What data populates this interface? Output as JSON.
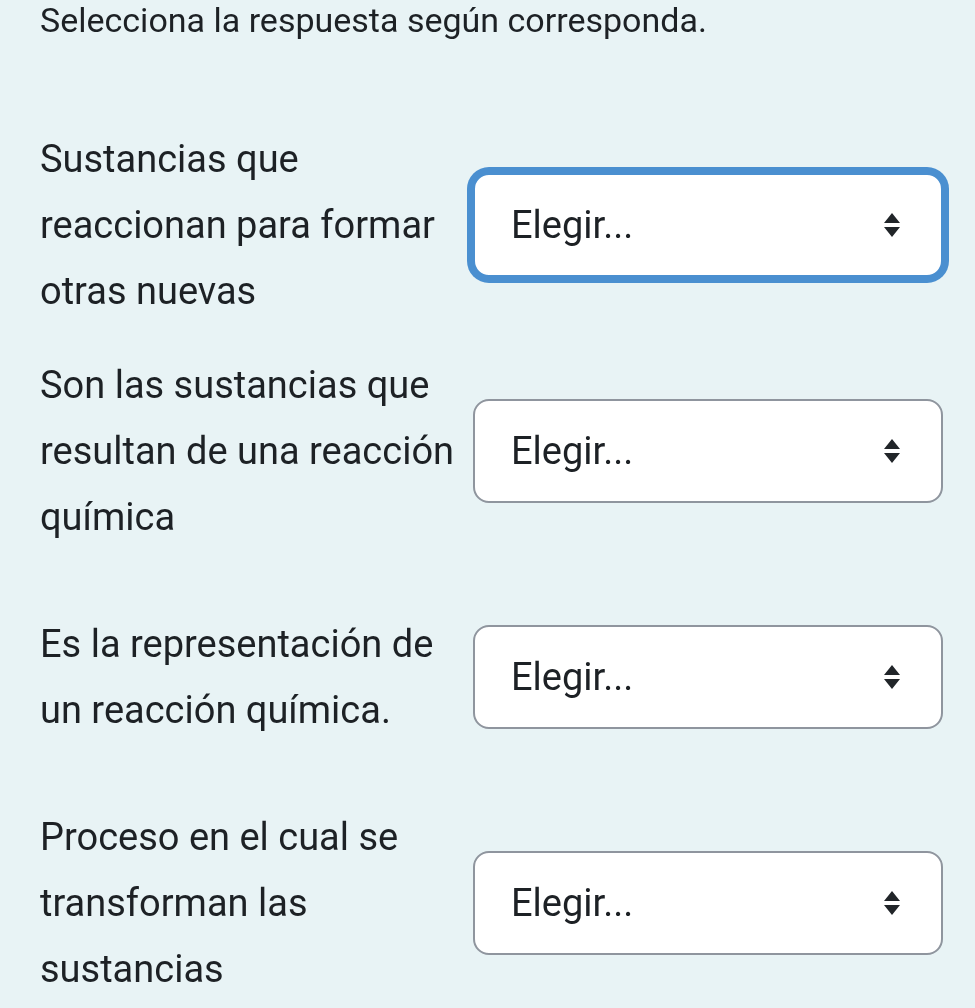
{
  "instruction": "Selecciona la respuesta según corresponda.",
  "questions": [
    {
      "text": "Sustancias que reaccionan para formar otras nuevas",
      "select": {
        "value": "Elegir...",
        "focused": true
      }
    },
    {
      "text": "Son las sustancias que resultan de una reacción química",
      "select": {
        "value": "Elegir...",
        "focused": false
      }
    },
    {
      "text": "Es la representación de un reacción química.",
      "select": {
        "value": "Elegir...",
        "focused": false
      }
    },
    {
      "text": "Proceso en el cual se transforman las sustancias",
      "select": {
        "value": "Elegir...",
        "focused": false
      }
    }
  ]
}
